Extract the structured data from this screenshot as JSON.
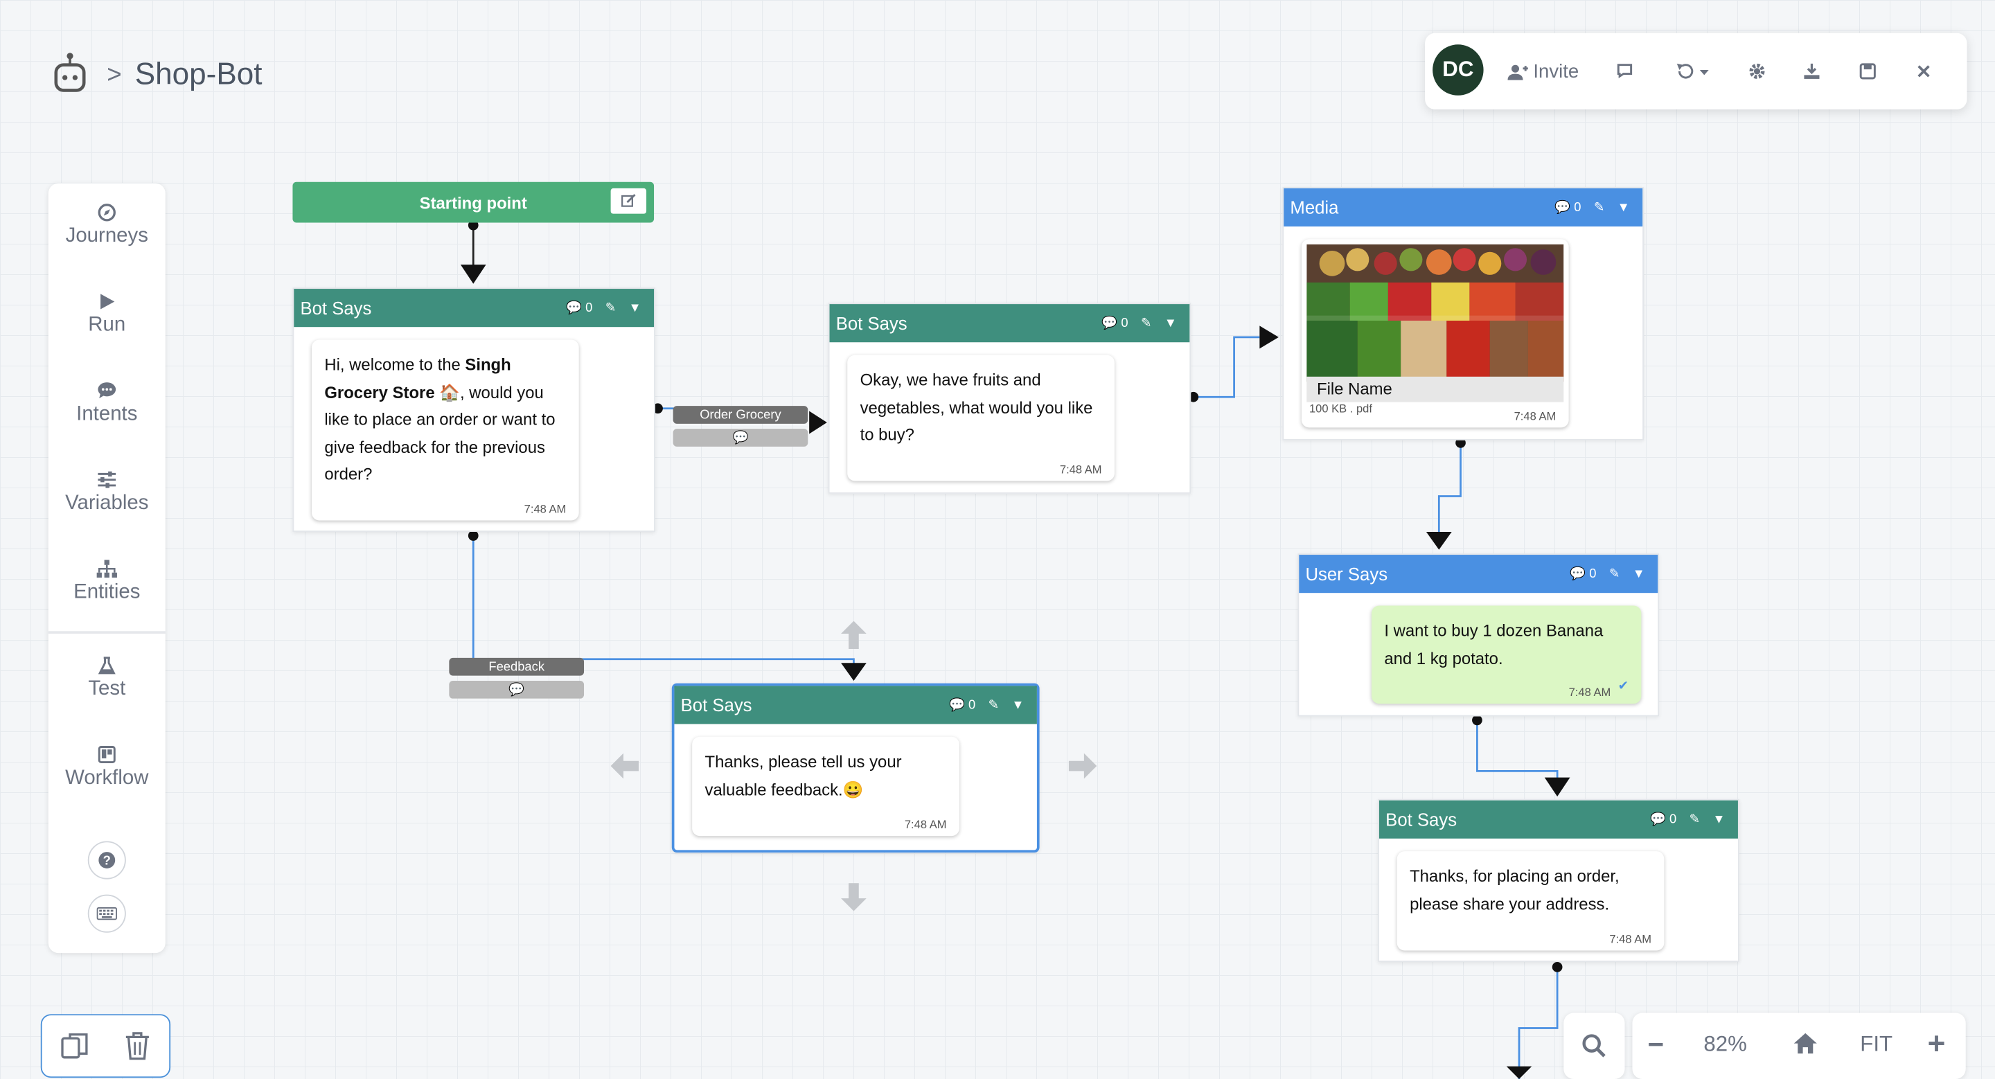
{
  "header": {
    "breadcrumb_sep": ">",
    "title": "Shop-Bot"
  },
  "topbar": {
    "avatar": "DC",
    "invite": "Invite",
    "icons": [
      "chat-icon",
      "history-icon",
      "settings-icon",
      "download-icon",
      "save-icon",
      "close-icon"
    ]
  },
  "sidebar": {
    "items": [
      {
        "label": "Journeys",
        "icon": "compass-icon"
      },
      {
        "label": "Run",
        "icon": "play-icon"
      },
      {
        "label": "Intents",
        "icon": "chat-bubble-icon"
      },
      {
        "label": "Variables",
        "icon": "sliders-icon"
      },
      {
        "label": "Entities",
        "icon": "sitemap-icon"
      },
      {
        "label": "Test",
        "icon": "flask-icon"
      },
      {
        "label": "Workflow",
        "icon": "trello-icon"
      }
    ]
  },
  "flow": {
    "start": {
      "label": "Starting point"
    },
    "node1": {
      "type": "Bot Says",
      "count": "0",
      "text_pre": "Hi, welcome to the ",
      "text_bold": "Singh Grocery Store",
      "text_emoji": " 🏠",
      "text_post": ", would you like to place an order or want to give feedback for the previous order?",
      "time": "7:48 AM"
    },
    "node2": {
      "type": "Bot Says",
      "count": "0",
      "text": "Okay, we have fruits and vegetables, what would you like to buy?",
      "time": "7:48 AM"
    },
    "node3": {
      "type": "Bot Says",
      "count": "0",
      "text": "Thanks, please tell us your valuable feedback.😀",
      "time": "7:48 AM"
    },
    "media": {
      "type": "Media",
      "count": "0",
      "file_name": "File Name",
      "file_meta": "100 KB . pdf",
      "time": "7:48 AM"
    },
    "user": {
      "type": "User Says",
      "count": "0",
      "text": "I want to buy 1 dozen Banana and 1 kg potato.",
      "time": "7:48 AM"
    },
    "node4": {
      "type": "Bot Says",
      "count": "0",
      "text": "Thanks, for placing an order, please share your address.",
      "time": "7:48 AM"
    },
    "labels": {
      "order": "Order Grocery",
      "feedback": "Feedback"
    }
  },
  "zoom": {
    "minus": "−",
    "level": "82%",
    "fit": "FIT",
    "plus": "+"
  },
  "colors": {
    "teal": "#3f8f7e",
    "blue": "#4a90e2",
    "start_green": "#4cae7a",
    "user_bubble": "#dcf7c5",
    "selection": "#4a90e2"
  }
}
